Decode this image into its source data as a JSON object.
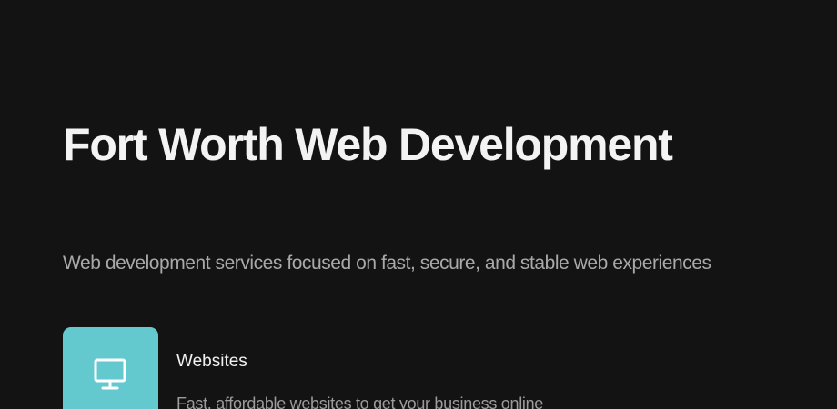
{
  "hero": {
    "title": "Fort Worth Web Development",
    "subtitle": "Web development services focused on fast, secure, and stable web experiences"
  },
  "services": [
    {
      "icon": "monitor-icon",
      "title": "Websites",
      "description": "Fast, affordable websites to get your business online"
    }
  ],
  "colors": {
    "background": "#141314",
    "accent": "#64c9cf",
    "title_text": "#f3f3f3",
    "muted_text": "#a9a9a9"
  }
}
